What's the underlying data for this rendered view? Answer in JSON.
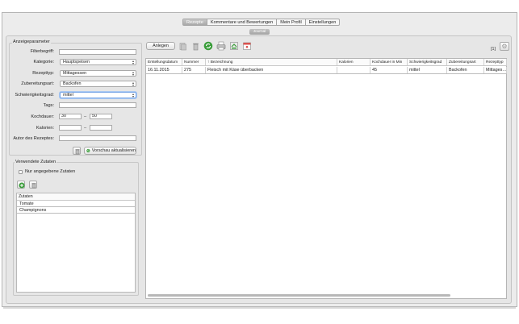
{
  "tabs": [
    "Rezepte",
    "Kommentare und Bewertungen",
    "Mein Profil",
    "Einstellungen"
  ],
  "active_tab": "Rezepte",
  "subtab": "Journal",
  "filter": {
    "legend": "Anzeigeparameter",
    "filterbegriff_label": "Filterbegriff:",
    "filterbegriff_value": "",
    "kategorie_label": "Kategorie:",
    "kategorie_value": "Hauptspeisen",
    "rezepttyp_label": "Rezepttyp:",
    "rezepttyp_value": "Mittagessen",
    "zubereitungsart_label": "Zubereitungsart:",
    "zubereitungsart_value": "Backofen",
    "schwierigkeitsgrad_label": "Schwierigkeitsgrad:",
    "schwierigkeitsgrad_value": "mittel",
    "tags_label": "Tags:",
    "tags_value": "",
    "kochdauer_label": "Kochdauer:",
    "kochdauer_from": "30",
    "kochdauer_to": "50",
    "kalorien_label": "Kalorien:",
    "kalorien_from": "",
    "kalorien_to": "",
    "range_sep": "–",
    "autor_label": "Autor des Rezeptes:",
    "autor_value": "",
    "vorschau_button": "Vorschau aktualisieren"
  },
  "zutaten": {
    "legend": "Verwendete Zutaten",
    "only_checkbox_label": "Nur angegebene Zutaten",
    "only_checked": false,
    "table_header": "Zutaten",
    "items": [
      "Tomate",
      "Champignons"
    ]
  },
  "toolbar": {
    "anlegen_label": "Anlegen",
    "page_count": "[1]"
  },
  "grid": {
    "columns": [
      "Erstellungsdatum",
      "Nummer",
      "↑ Bezeichnung",
      "Kalorien",
      "Kochdauer in Min",
      "Schwierigkeitsgrad",
      "Zubereitungsart",
      "Rezepttyp"
    ],
    "rows": [
      [
        "16.11.2015",
        "275",
        "Fleisch mit Käse überbacken",
        "",
        "45",
        "mittel",
        "Backofen",
        "Mittages…"
      ]
    ]
  },
  "colors": {
    "accent_green": "#3a9d3a",
    "focus_blue": "#7aa7e6"
  }
}
